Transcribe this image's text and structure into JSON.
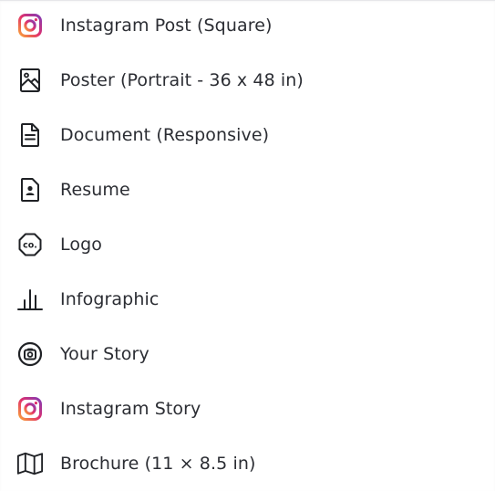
{
  "menu": {
    "items": [
      {
        "label": "Instagram Post (Square)",
        "icon": "instagram-icon"
      },
      {
        "label": "Poster (Portrait - 36 x 48 in)",
        "icon": "image-icon"
      },
      {
        "label": "Document (Responsive)",
        "icon": "document-icon"
      },
      {
        "label": "Resume",
        "icon": "resume-icon"
      },
      {
        "label": "Logo",
        "icon": "logo-co-icon"
      },
      {
        "label": "Infographic",
        "icon": "infographic-icon"
      },
      {
        "label": "Your Story",
        "icon": "story-camera-icon"
      },
      {
        "label": "Instagram Story",
        "icon": "instagram-icon"
      },
      {
        "label": "Brochure (11 × 8.5 in)",
        "icon": "brochure-map-icon"
      }
    ]
  },
  "colors": {
    "text": "#2b2d33",
    "icon_stroke": "#1f2125",
    "instagram_gradient": [
      "#f9a13a",
      "#e1306c",
      "#833ab4"
    ]
  }
}
